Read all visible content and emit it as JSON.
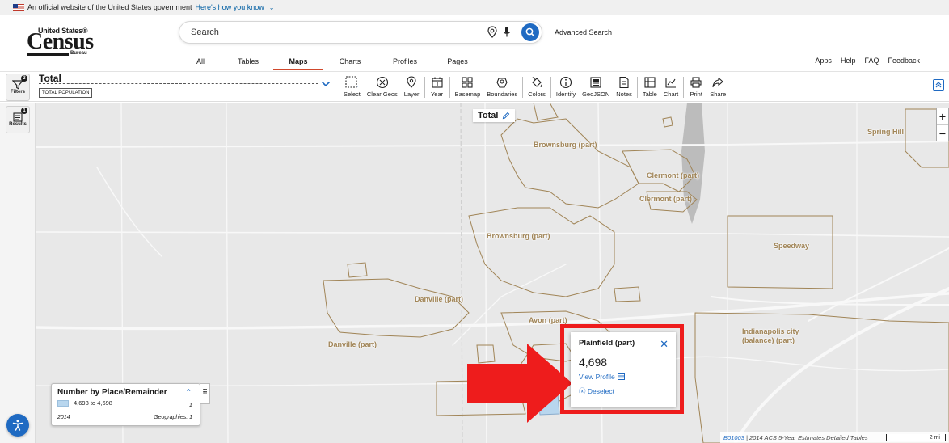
{
  "gov_banner": {
    "text": "An official website of the United States government",
    "link": "Here's how you know"
  },
  "logo": {
    "top": "United States®",
    "main": "Census",
    "bottom": "Bureau"
  },
  "search": {
    "placeholder": "Search",
    "advanced_label": "Advanced Search"
  },
  "nav_tabs": [
    {
      "label": "All",
      "active": false
    },
    {
      "label": "Tables",
      "active": false
    },
    {
      "label": "Maps",
      "active": true
    },
    {
      "label": "Charts",
      "active": false
    },
    {
      "label": "Profiles",
      "active": false
    },
    {
      "label": "Pages",
      "active": false
    }
  ],
  "right_links": [
    "Apps",
    "Help",
    "FAQ",
    "Feedback"
  ],
  "sidebar": {
    "filters": {
      "label": "Filters",
      "badge": "3"
    },
    "results": {
      "label": "Results",
      "badge": "1"
    }
  },
  "table_selector": {
    "title": "Total",
    "code": "TOTAL POPULATION"
  },
  "tools": {
    "select": "Select",
    "clear_geos": "Clear Geos",
    "layer": "Layer",
    "year": "Year",
    "basemap": "Basemap",
    "boundaries": "Boundaries",
    "colors": "Colors",
    "identify": "Identify",
    "geojson": "GeoJSON",
    "notes": "Notes",
    "table": "Table",
    "chart": "Chart",
    "print": "Print",
    "share": "Share"
  },
  "map": {
    "title": "Total",
    "places": {
      "brownsburg_top": "Brownsburg (part)",
      "clermont_1": "Clermont (part)",
      "clermont_2": "Clermont (part)",
      "spring_hill": "Spring Hill",
      "brownsburg_mid": "Brownsburg (part)",
      "speedway": "Speedway",
      "danville_1": "Danville (part)",
      "avon": "Avon (part)",
      "danville_2": "Danville (part)",
      "indy_1": "Indianapolis city",
      "indy_2": "(balance) (part)"
    }
  },
  "legend": {
    "title": "Number by Place/Remainder",
    "range": "4,698 to 4,698",
    "count": "1",
    "year": "2014",
    "geographies": "Geographies: 1"
  },
  "popup": {
    "name": "Plainfield (part)",
    "value": "4,698",
    "view_profile": "View Profile",
    "deselect": "Deselect"
  },
  "attribution": {
    "code": "B01003",
    "source": "| 2014 ACS 5-Year Estimates Detailed Tables",
    "scale": "2 mi"
  },
  "colors": {
    "accent": "#1f6ac2",
    "highlight_frame": "#ee1c1c",
    "boundary": "#a08456",
    "selected_fill": "#b8d6ee"
  }
}
